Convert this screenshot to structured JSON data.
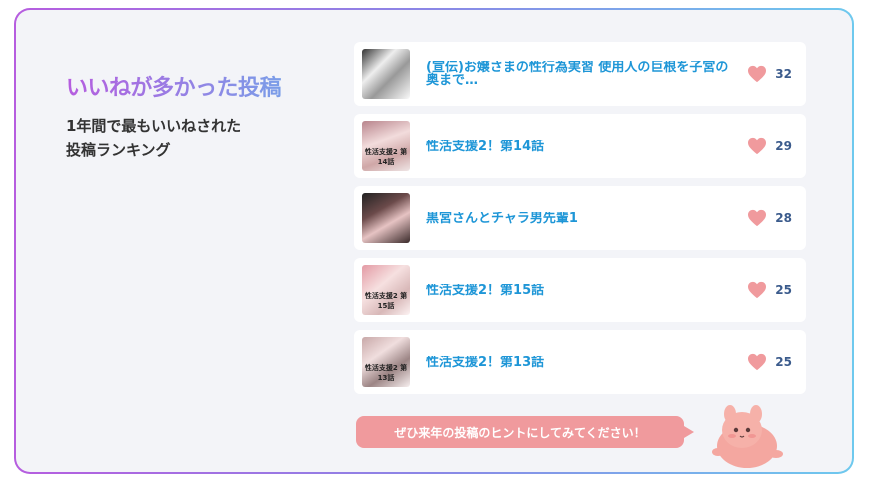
{
  "section": {
    "title": "いいねが多かった投稿",
    "subtitle_lines": [
      "1年間で最もいいねされた",
      "投稿ランキング"
    ]
  },
  "posts": [
    {
      "title": "(宣伝)お嬢さまの性行為実習 使用人の巨根を子宮の奥まで…",
      "likes": "32",
      "thumb_caption": ""
    },
    {
      "title": "性活支援2！第14話",
      "likes": "29",
      "thumb_caption": "性活支援2 第14話"
    },
    {
      "title": "黒宮さんとチャラ男先輩1",
      "likes": "28",
      "thumb_caption": ""
    },
    {
      "title": "性活支援2！第15話",
      "likes": "25",
      "thumb_caption": "性活支援2 第15話"
    },
    {
      "title": "性活支援2！第13話",
      "likes": "25",
      "thumb_caption": "性活支援2 第13話"
    }
  ],
  "hint_bubble": "ぜひ来年の投稿のヒントにしてみてください！",
  "colors": {
    "title_gradient": [
      "#b65ddf",
      "#7a9de8"
    ],
    "post_title": "#1e96d7",
    "heart": "#f09a9d",
    "like_count": "#3b5b8c",
    "bubble": "#f09a9d",
    "panel_bg": "#f3f4f8"
  },
  "icons": {
    "like": "heart-icon",
    "mascot": "pink-blob-mascot"
  }
}
